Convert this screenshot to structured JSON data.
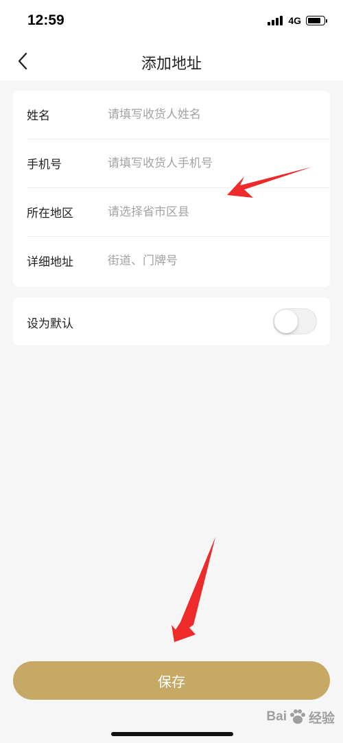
{
  "status_bar": {
    "time": "12:59",
    "network": "4G"
  },
  "nav": {
    "title": "添加地址",
    "back_icon": "chevron-left-icon"
  },
  "form": {
    "fields": [
      {
        "label": "姓名",
        "placeholder": "请填写收货人姓名",
        "value": ""
      },
      {
        "label": "手机号",
        "placeholder": "请填写收货人手机号",
        "value": ""
      },
      {
        "label": "所在地区",
        "placeholder": "请选择省市区县",
        "value": ""
      },
      {
        "label": "详细地址",
        "placeholder": "街道、门牌号",
        "value": ""
      }
    ]
  },
  "default_setting": {
    "label": "设为默认",
    "enabled": false
  },
  "save_button": {
    "label": "保存"
  },
  "watermark": {
    "left": "Bai",
    "right": "经验"
  },
  "colors": {
    "accent": "#c6a965",
    "background": "#f6f6f6",
    "annotation": "#ee2a2a"
  }
}
